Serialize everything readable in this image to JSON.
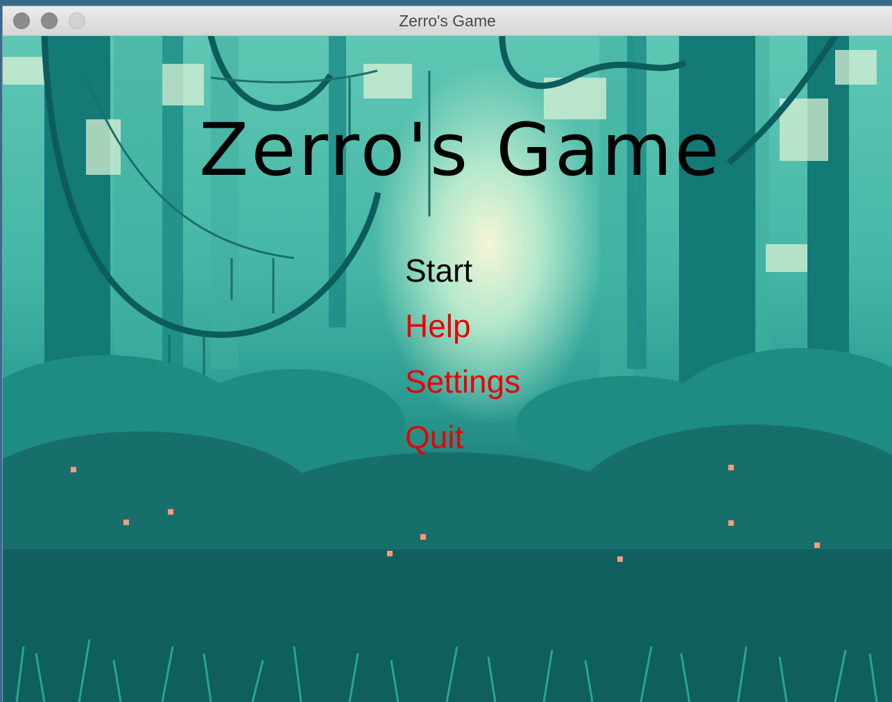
{
  "window": {
    "title": "Zerro's Game"
  },
  "game": {
    "title": "Zerro's Game",
    "menu": [
      {
        "label": "Start",
        "selected": true
      },
      {
        "label": "Help",
        "selected": false
      },
      {
        "label": "Settings",
        "selected": false
      },
      {
        "label": "Quit",
        "selected": false
      }
    ],
    "colors": {
      "selected_item": "#000000",
      "unselected_item": "#ea0000"
    }
  }
}
